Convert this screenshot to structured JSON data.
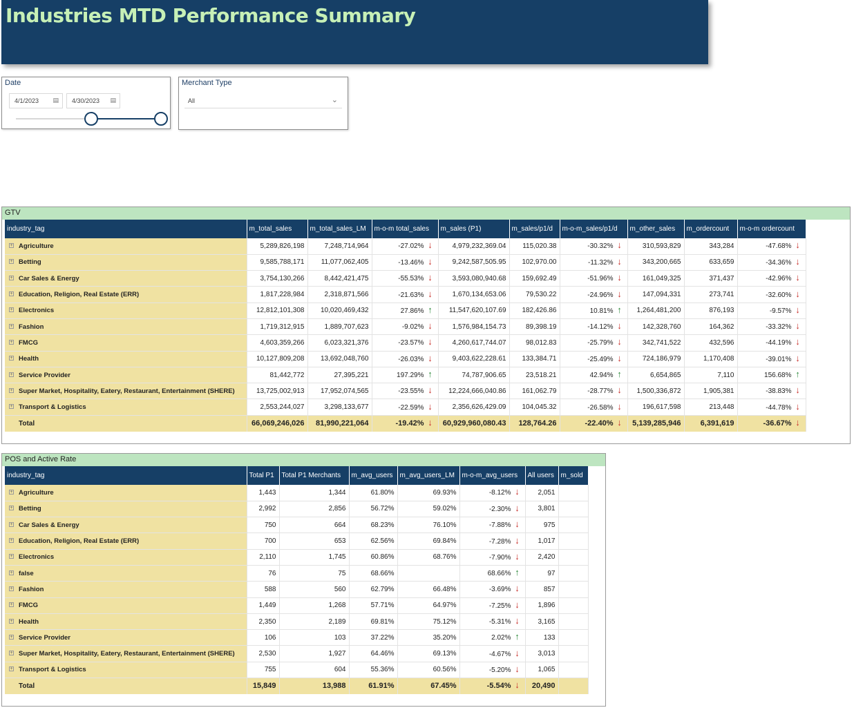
{
  "title": "Industries MTD Performance Summary",
  "date_slicer": {
    "title": "Date",
    "start": "4/1/2023",
    "end": "4/30/2023",
    "start_pct": 0.52,
    "end_pct": 1.0
  },
  "merchant_slicer": {
    "title": "Merchant Type",
    "value": "All"
  },
  "gtv": {
    "title": "GTV",
    "columns": [
      "industry_tag",
      "m_total_sales",
      "m_total_sales_LM",
      "m-o-m total_sales",
      "m_sales (P1)",
      "m_sales/p1/d",
      "m-o-m_sales/p1/d",
      "m_other_sales",
      "m_ordercount",
      "m-o-m ordercount"
    ],
    "rows": [
      {
        "tag": "Agriculture",
        "c": [
          "5,289,826,198",
          "7,248,714,964",
          "-27.02%",
          "4,979,232,369.04",
          "115,020.38",
          "-30.32%",
          "310,593,829",
          "343,284",
          "-47.68%"
        ],
        "d": [
          "down",
          "down",
          "down"
        ]
      },
      {
        "tag": "Betting",
        "c": [
          "9,585,788,171",
          "11,077,062,405",
          "-13.46%",
          "9,242,587,505.95",
          "102,970.00",
          "-11.32%",
          "343,200,665",
          "633,659",
          "-34.36%"
        ],
        "d": [
          "down",
          "down",
          "down"
        ]
      },
      {
        "tag": "Car Sales & Energy",
        "c": [
          "3,754,130,266",
          "8,442,421,475",
          "-55.53%",
          "3,593,080,940.68",
          "159,692.49",
          "-51.96%",
          "161,049,325",
          "371,437",
          "-42.96%"
        ],
        "d": [
          "down",
          "down",
          "down"
        ]
      },
      {
        "tag": "Education, Religion, Real Estate (ERR)",
        "c": [
          "1,817,228,984",
          "2,318,871,566",
          "-21.63%",
          "1,670,134,653.06",
          "79,530.22",
          "-24.96%",
          "147,094,331",
          "273,741",
          "-32.60%"
        ],
        "d": [
          "down",
          "down",
          "down"
        ]
      },
      {
        "tag": "Electronics",
        "c": [
          "12,812,101,308",
          "10,020,469,432",
          "27.86%",
          "11,547,620,107.69",
          "182,426.86",
          "10.81%",
          "1,264,481,200",
          "876,193",
          "-9.57%"
        ],
        "d": [
          "up",
          "up",
          "down"
        ]
      },
      {
        "tag": "Fashion",
        "c": [
          "1,719,312,915",
          "1,889,707,623",
          "-9.02%",
          "1,576,984,154.73",
          "89,398.19",
          "-14.12%",
          "142,328,760",
          "164,362",
          "-33.32%"
        ],
        "d": [
          "down",
          "down",
          "down"
        ]
      },
      {
        "tag": "FMCG",
        "c": [
          "4,603,359,266",
          "6,023,321,376",
          "-23.57%",
          "4,260,617,744.07",
          "98,012.83",
          "-25.79%",
          "342,741,522",
          "432,596",
          "-44.19%"
        ],
        "d": [
          "down",
          "down",
          "down"
        ]
      },
      {
        "tag": "Health",
        "c": [
          "10,127,809,208",
          "13,692,048,760",
          "-26.03%",
          "9,403,622,228.61",
          "133,384.71",
          "-25.49%",
          "724,186,979",
          "1,170,408",
          "-39.01%"
        ],
        "d": [
          "down",
          "down",
          "down"
        ]
      },
      {
        "tag": "Service Provider",
        "c": [
          "81,442,772",
          "27,395,221",
          "197.29%",
          "74,787,906.65",
          "23,518.21",
          "42.94%",
          "6,654,865",
          "7,110",
          "156.68%"
        ],
        "d": [
          "up",
          "up",
          "up"
        ]
      },
      {
        "tag": "Super Market, Hospitality, Eatery, Restaurant, Entertainment (SHERE)",
        "c": [
          "13,725,002,913",
          "17,952,074,565",
          "-23.55%",
          "12,224,666,040.86",
          "161,062.79",
          "-28.77%",
          "1,500,336,872",
          "1,905,381",
          "-38.83%"
        ],
        "d": [
          "down",
          "down",
          "down"
        ]
      },
      {
        "tag": "Transport & Logistics",
        "c": [
          "2,553,244,027",
          "3,298,133,677",
          "-22.59%",
          "2,356,626,429.09",
          "104,045.32",
          "-26.58%",
          "196,617,598",
          "213,448",
          "-44.78%"
        ],
        "d": [
          "down",
          "down",
          "down"
        ]
      }
    ],
    "total": {
      "tag": "Total",
      "c": [
        "66,069,246,026",
        "81,990,221,064",
        "-19.42%",
        "60,929,960,080.43",
        "128,764.26",
        "-22.40%",
        "5,139,285,946",
        "6,391,619",
        "-36.67%"
      ],
      "d": [
        "down",
        "down",
        "down"
      ]
    }
  },
  "pos": {
    "title": "POS and Active Rate",
    "columns": [
      "industry_tag",
      "Total P1",
      "Total P1 Merchants",
      "m_avg_users",
      "m_avg_users_LM",
      "m-o-m_avg_users",
      "All users",
      "m_sold"
    ],
    "rows": [
      {
        "tag": "Agriculture",
        "c": [
          "1,443",
          "1,344",
          "61.80%",
          "69.93%",
          "-8.12%",
          "2,051",
          ""
        ],
        "d": "down"
      },
      {
        "tag": "Betting",
        "c": [
          "2,992",
          "2,856",
          "56.72%",
          "59.02%",
          "-2.30%",
          "3,801",
          ""
        ],
        "d": "down"
      },
      {
        "tag": "Car Sales & Energy",
        "c": [
          "750",
          "664",
          "68.23%",
          "76.10%",
          "-7.88%",
          "975",
          ""
        ],
        "d": "down"
      },
      {
        "tag": "Education, Religion, Real Estate (ERR)",
        "c": [
          "700",
          "653",
          "62.56%",
          "69.84%",
          "-7.28%",
          "1,017",
          ""
        ],
        "d": "down"
      },
      {
        "tag": "Electronics",
        "c": [
          "2,110",
          "1,745",
          "60.86%",
          "68.76%",
          "-7.90%",
          "2,420",
          ""
        ],
        "d": "down"
      },
      {
        "tag": "false",
        "c": [
          "76",
          "75",
          "68.66%",
          "",
          "68.66%",
          "97",
          ""
        ],
        "d": "up"
      },
      {
        "tag": "Fashion",
        "c": [
          "588",
          "560",
          "62.79%",
          "66.48%",
          "-3.69%",
          "857",
          ""
        ],
        "d": "down"
      },
      {
        "tag": "FMCG",
        "c": [
          "1,449",
          "1,268",
          "57.71%",
          "64.97%",
          "-7.25%",
          "1,896",
          ""
        ],
        "d": "down"
      },
      {
        "tag": "Health",
        "c": [
          "2,350",
          "2,189",
          "69.81%",
          "75.12%",
          "-5.31%",
          "3,165",
          ""
        ],
        "d": "down"
      },
      {
        "tag": "Service Provider",
        "c": [
          "106",
          "103",
          "37.22%",
          "35.20%",
          "2.02%",
          "133",
          ""
        ],
        "d": "up"
      },
      {
        "tag": "Super Market, Hospitality, Eatery, Restaurant, Entertainment (SHERE)",
        "c": [
          "2,530",
          "1,927",
          "64.46%",
          "69.13%",
          "-4.67%",
          "3,013",
          ""
        ],
        "d": "down"
      },
      {
        "tag": "Transport & Logistics",
        "c": [
          "755",
          "604",
          "55.36%",
          "60.56%",
          "-5.20%",
          "1,065",
          ""
        ],
        "d": "down"
      }
    ],
    "total": {
      "tag": "Total",
      "c": [
        "15,849",
        "13,988",
        "61.91%",
        "67.45%",
        "-5.54%",
        "20,490",
        ""
      ],
      "d": "down"
    }
  }
}
